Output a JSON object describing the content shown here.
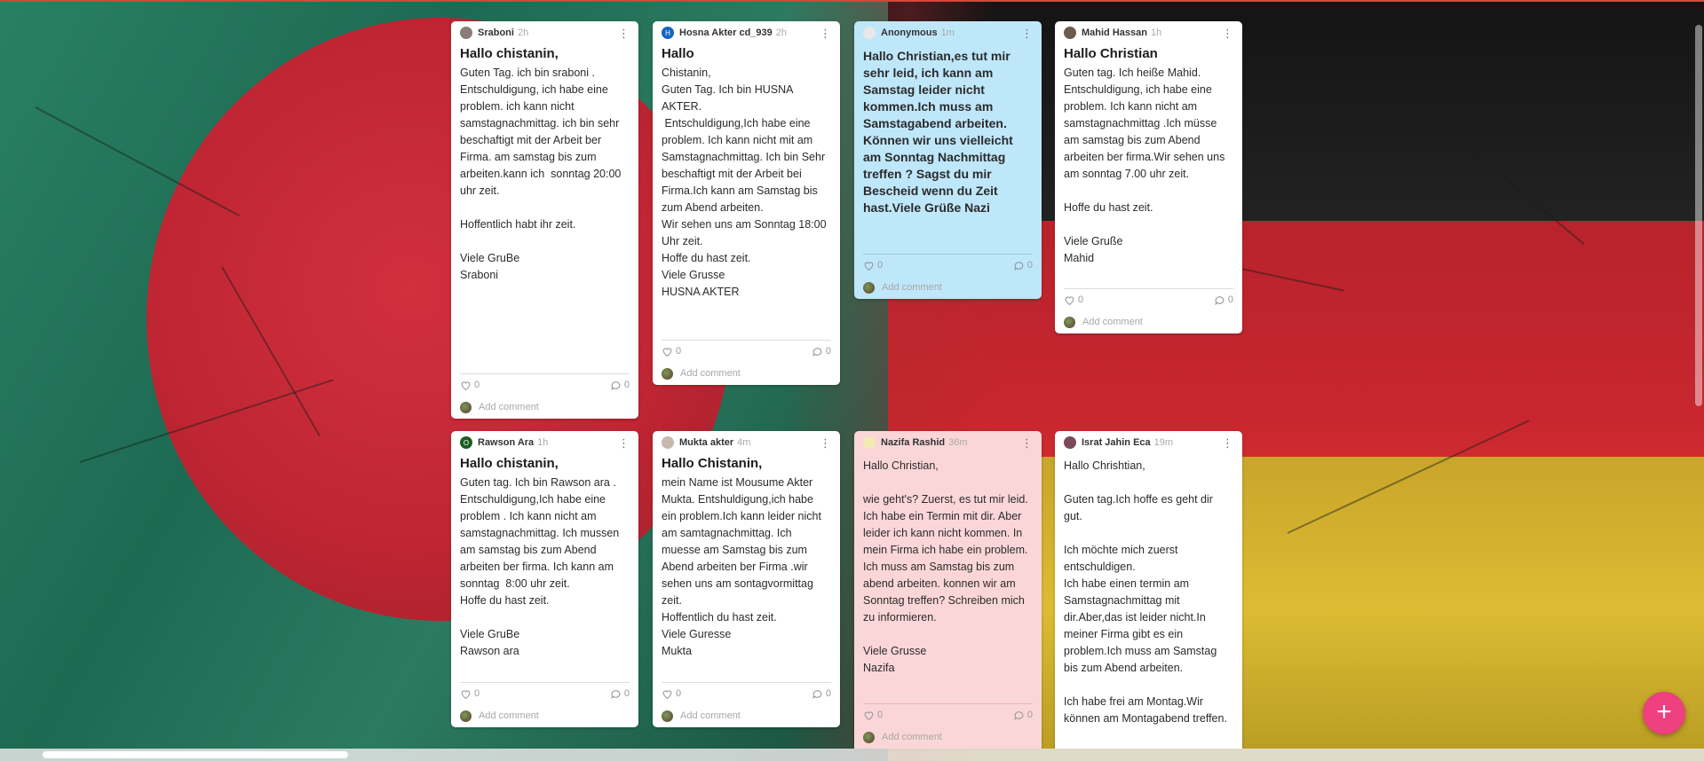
{
  "colors": {
    "card": "#ffffff",
    "blue_card": "#bfe7fa",
    "pink_card": "#fbd6d8",
    "fab": "#ee3f7f"
  },
  "cards": [
    {
      "author": "Sraboni",
      "time": "2h",
      "title": "Hallo chistanin,",
      "body": "Guten Tag. ich bin sraboni .\nEntschuldigung, ich habe eine problem. ich kann nicht samstagnachmittag. ich bin sehr beschaftigt mit der Arbeit ber Firma. am samstag bis zum arbeiten.kann ich  sonntag 20:00 uhr zeit.\n\nHoffentlich habt ihr zeit.\n\nViele GruBe\nSraboni",
      "likes": "0",
      "comments": "0",
      "add_comment": "Add comment"
    },
    {
      "author": "Hosna Akter cd_939",
      "time": "2h",
      "title": "Hallo",
      "body": "Chistanin,\nGuten Tag. Ich bin HUSNA AKTER.\n Entschuldigung,Ich habe eine problem. Ich kann nicht mit am Samstagnachmittag. Ich bin Sehr beschaftigt mit der Arbeit bei Firma.Ich kann am Samstag bis zum Abend arbeiten.\nWir sehen uns am Sonntag 18:00 Uhr zeit.\nHoffe du hast zeit.\nViele Grusse\nHUSNA AKTER",
      "likes": "0",
      "comments": "0",
      "add_comment": "Add comment"
    },
    {
      "author": "Anonymous",
      "time": "1m",
      "title": "",
      "body": "Hallo Christian,es tut mir sehr leid, ich kann am Samstag leider nicht kommen.Ich muss am Samstagabend arbeiten. Können wir uns vielleicht am Sonntag Nachmittag treffen ? Sagst du mir Bescheid wenn du Zeit hast.Viele Grüße Nazi",
      "likes": "0",
      "comments": "0",
      "add_comment": "Add comment"
    },
    {
      "author": "Mahid Hassan",
      "time": "1h",
      "title": "Hallo Christian",
      "body": "Guten tag. Ich heiße Mahid.\nEntschuldigung, ich habe eine problem. Ich kann nicht am samstagnachmittag .Ich müsse am samstag bis zum Abend arbeiten ber firma.Wir sehen uns am sonntag 7.00 uhr zeit.\n\nHoffe du hast zeit.\n\nViele Gruße\nMahid",
      "likes": "0",
      "comments": "0",
      "add_comment": "Add comment"
    },
    {
      "author": "Rawson Ara",
      "time": "1h",
      "title": "Hallo chistanin,",
      "body": "Guten tag. Ich bin Rawson ara .\nEntschuldigung,Ich habe eine problem . Ich kann nicht am samstagnachmittag. Ich mussen am samstag bis zum Abend arbeiten ber firma. Ich kann am sonntag  8:00 uhr zeit.\nHoffe du hast zeit.\n\nViele GruBe\nRawson ara",
      "likes": "0",
      "comments": "0",
      "add_comment": "Add comment"
    },
    {
      "author": "Mukta akter",
      "time": "4m",
      "title": "Hallo Chistanin,",
      "body": "mein Name ist Mousume Akter Mukta. Entshuldigung,ich habe ein problem.Ich kann leider nicht am samtagnachmittag. Ich muesse am Samstag bis zum Abend arbeiten ber Firma .wir sehen uns am sontagvormittag zeit.\nHoffentlich du hast zeit.\nViele Guresse\nMukta",
      "likes": "0",
      "comments": "0",
      "add_comment": "Add comment"
    },
    {
      "author": "Nazifa Rashid",
      "time": "36m",
      "title": "",
      "body": "Hallo Christian,\n\nwie geht's? Zuerst, es tut mir leid. Ich habe ein Termin mit dir. Aber leider ich kann nicht kommen. In mein Firma ich habe ein problem. Ich muss am Samstag bis zum abend arbeiten. konnen wir am Sonntag treffen? Schreiben mich zu informieren.\n\nViele Grusse\nNazifa",
      "likes": "0",
      "comments": "0",
      "add_comment": "Add comment"
    },
    {
      "author": "Israt Jahin Eca",
      "time": "19m",
      "title": "",
      "body": "Hallo Chrishtian,\n\nGuten tag.Ich hoffe es geht dir gut.\n\nIch möchte mich zuerst entschuldigen.\nIch habe einen termin am Samstagnachmittag mit dir.Aber,das ist leider nicht.In meiner Firma gibt es ein problem.Ich muss am Samstag bis zum Abend arbeiten.\n\nIch habe frei am Montag.Wir können am Montagabend treffen.",
      "likes": "",
      "comments": "",
      "add_comment": ""
    }
  ],
  "fab": {
    "label": "+"
  }
}
